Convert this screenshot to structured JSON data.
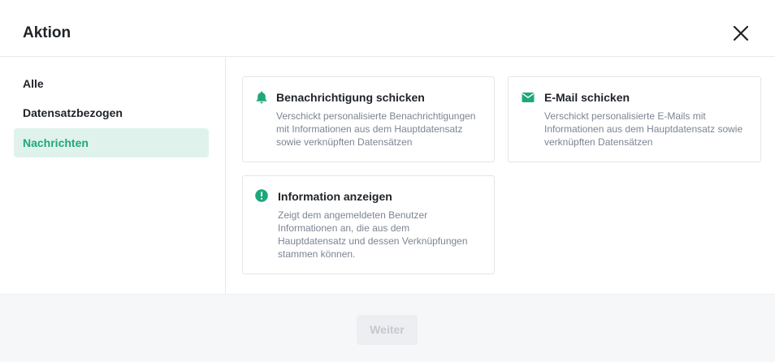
{
  "dialog": {
    "title": "Aktion",
    "close_icon": "close-icon"
  },
  "sidebar": {
    "items": [
      {
        "label": "Alle",
        "active": false
      },
      {
        "label": "Datensatzbezogen",
        "active": false
      },
      {
        "label": "Nachrichten",
        "active": true
      }
    ]
  },
  "cards": [
    {
      "icon": "bell-icon",
      "title": "Benachrichtigung schicken",
      "desc_lines": [
        "Verschickt personalisierte Benachrichtigungen",
        "mit Informationen aus dem Hauptdatensatz",
        "sowie verknüpften Datensätzen"
      ]
    },
    {
      "icon": "envelope-icon",
      "title": "E-Mail schicken",
      "desc_lines": [
        "Verschickt personalisierte E-Mails mit",
        "Informationen aus dem Hauptdatensatz sowie",
        "verknüpften Datensätzen"
      ]
    },
    {
      "icon": "exclamation-circle-icon",
      "title": "Information anzeigen",
      "desc_lines": [
        "Zeigt dem angemeldeten Benutzer",
        "Informationen an, die aus dem",
        "Hauptdatensatz und dessen Verknüpfungen",
        "stammen können."
      ]
    }
  ],
  "footer": {
    "next_label": "Weiter",
    "next_disabled": true
  },
  "colors": {
    "accent": "#1fa77c",
    "active_bg": "#dff3ec",
    "muted_text": "#7c8493",
    "border": "#e3e5e8",
    "footer_bg": "#f6f7f9"
  }
}
